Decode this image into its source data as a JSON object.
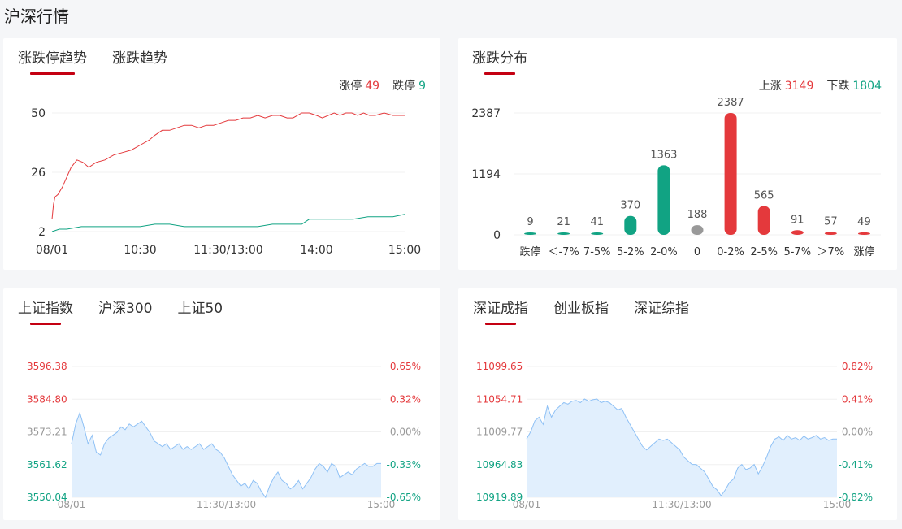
{
  "page": {
    "title": "沪深行情"
  },
  "colors": {
    "red": "#e4393c",
    "green": "#11a383",
    "gray": "#999999",
    "blue_line": "#8fc1f5",
    "blue_fill": "#e1effd",
    "accent": "#c40012"
  },
  "panel1": {
    "tabs": [
      "涨跌停趋势",
      "涨跌趋势"
    ],
    "legend": {
      "up_label": "涨停",
      "up_value": "49",
      "down_label": "跌停",
      "down_value": "9"
    }
  },
  "panel2": {
    "tabs": [
      "涨跌分布"
    ],
    "legend": {
      "up_label": "上涨",
      "up_value": "3149",
      "down_label": "下跌",
      "down_value": "1804"
    }
  },
  "panel3": {
    "tabs": [
      "上证指数",
      "沪深300",
      "上证50"
    ]
  },
  "panel4": {
    "tabs": [
      "深证成指",
      "创业板指",
      "深证综指"
    ]
  },
  "chart_data": [
    {
      "type": "line",
      "yticks": [
        "50",
        "26",
        "2"
      ],
      "ylim": [
        2,
        50
      ],
      "xticks": [
        "08/01",
        "10:30",
        "11:30/13:00",
        "14:00",
        "15:00"
      ],
      "series": [
        {
          "name": "涨停",
          "color": "#e4393c",
          "points": [
            [
              0,
              7
            ],
            [
              1,
              13
            ],
            [
              2,
              16
            ],
            [
              4,
              17
            ],
            [
              7,
              20
            ],
            [
              10,
              24
            ],
            [
              13,
              28
            ],
            [
              17,
              31
            ],
            [
              21,
              30
            ],
            [
              25,
              28
            ],
            [
              30,
              30
            ],
            [
              36,
              31
            ],
            [
              42,
              33
            ],
            [
              48,
              34
            ],
            [
              54,
              35
            ],
            [
              60,
              37
            ],
            [
              66,
              39
            ],
            [
              70,
              41
            ],
            [
              75,
              43
            ],
            [
              80,
              43
            ],
            [
              85,
              44
            ],
            [
              90,
              45
            ],
            [
              95,
              45
            ],
            [
              100,
              44
            ],
            [
              105,
              45
            ],
            [
              110,
              45
            ],
            [
              115,
              46
            ],
            [
              120,
              47
            ],
            [
              125,
              47
            ],
            [
              130,
              48
            ],
            [
              135,
              48
            ],
            [
              140,
              49
            ],
            [
              145,
              48
            ],
            [
              150,
              49
            ],
            [
              155,
              49
            ],
            [
              160,
              48
            ],
            [
              164,
              48
            ],
            [
              170,
              50
            ],
            [
              175,
              50
            ],
            [
              180,
              49
            ],
            [
              184,
              48
            ],
            [
              188,
              49
            ],
            [
              192,
              50
            ],
            [
              196,
              49
            ],
            [
              200,
              50
            ],
            [
              204,
              50
            ],
            [
              208,
              49
            ],
            [
              212,
              50
            ],
            [
              216,
              49
            ],
            [
              220,
              49
            ],
            [
              226,
              50
            ],
            [
              232,
              49
            ],
            [
              240,
              49
            ]
          ]
        },
        {
          "name": "跌停",
          "color": "#11a383",
          "points": [
            [
              0,
              2
            ],
            [
              5,
              3
            ],
            [
              10,
              3
            ],
            [
              20,
              4
            ],
            [
              30,
              4
            ],
            [
              40,
              4
            ],
            [
              50,
              4
            ],
            [
              60,
              4
            ],
            [
              70,
              5
            ],
            [
              80,
              5
            ],
            [
              90,
              4
            ],
            [
              100,
              4
            ],
            [
              110,
              4
            ],
            [
              120,
              4
            ],
            [
              130,
              4
            ],
            [
              140,
              4
            ],
            [
              150,
              5
            ],
            [
              160,
              5
            ],
            [
              170,
              5
            ],
            [
              175,
              7
            ],
            [
              185,
              7
            ],
            [
              195,
              7
            ],
            [
              205,
              7
            ],
            [
              215,
              8
            ],
            [
              225,
              8
            ],
            [
              232,
              8
            ],
            [
              240,
              9
            ]
          ]
        }
      ]
    },
    {
      "type": "bar",
      "categories": [
        "跌停",
        "＜-7%",
        "7-5%",
        "5-2%",
        "2-0%",
        "0",
        "0-2%",
        "2-5%",
        "5-7%",
        "＞7%",
        "涨停"
      ],
      "values": [
        9,
        21,
        41,
        370,
        1363,
        188,
        2387,
        565,
        91,
        57,
        49
      ],
      "colors": [
        "#11a383",
        "#11a383",
        "#11a383",
        "#11a383",
        "#11a383",
        "#999999",
        "#e4393c",
        "#e4393c",
        "#e4393c",
        "#e4393c",
        "#e4393c"
      ],
      "yticks": [
        "2387",
        "1194",
        "0"
      ],
      "ylim": [
        0,
        2387
      ]
    },
    {
      "type": "area",
      "name": "上证指数",
      "left_ticks": [
        "3596.38",
        "3584.80",
        "3573.21",
        "3561.62",
        "3550.04"
      ],
      "right_ticks": [
        "0.65%",
        "0.32%",
        "0.00%",
        "-0.33%",
        "-0.65%"
      ],
      "ylim": [
        3550.04,
        3596.38
      ],
      "xticks": [
        "08/01",
        "11:30/13:00",
        "15:00"
      ],
      "values": [
        3569,
        3576,
        3580,
        3575,
        3569,
        3572,
        3566,
        3565,
        3569,
        3571,
        3572,
        3573,
        3575,
        3574,
        3576,
        3575,
        3576,
        3577,
        3575,
        3573,
        3570,
        3569,
        3568,
        3569,
        3567,
        3568,
        3569,
        3567,
        3568,
        3567,
        3568,
        3569,
        3567,
        3568,
        3569,
        3567,
        3566,
        3564,
        3561,
        3558,
        3556,
        3554,
        3555,
        3553,
        3556,
        3555,
        3552,
        3550,
        3554,
        3557,
        3559,
        3556,
        3555,
        3553,
        3554,
        3556,
        3553,
        3555,
        3557,
        3560,
        3562,
        3561,
        3559,
        3562,
        3561,
        3557,
        3558,
        3559,
        3558,
        3560,
        3561,
        3562,
        3561,
        3561,
        3562,
        3562
      ]
    },
    {
      "type": "area",
      "name": "深证成指",
      "left_ticks": [
        "11099.65",
        "11054.71",
        "11009.77",
        "10964.83",
        "10919.89"
      ],
      "right_ticks": [
        "0.82%",
        "0.41%",
        "0.00%",
        "-0.41%",
        "-0.82%"
      ],
      "ylim": [
        10919.89,
        11099.65
      ],
      "xticks": [
        "08/01",
        "11:30/13:00",
        "15:00"
      ],
      "values": [
        11000,
        11010,
        11025,
        11030,
        11020,
        11045,
        11030,
        11040,
        11045,
        11050,
        11048,
        11052,
        11053,
        11050,
        11055,
        11052,
        11054,
        11055,
        11050,
        11052,
        11050,
        11045,
        11040,
        11042,
        11030,
        11020,
        11010,
        11000,
        10990,
        10985,
        10990,
        10995,
        11000,
        10998,
        11000,
        10995,
        10990,
        10985,
        10975,
        10970,
        10965,
        10965,
        10960,
        10955,
        10945,
        10935,
        10930,
        10922,
        10930,
        10940,
        10945,
        10960,
        10965,
        10958,
        10960,
        10965,
        10952,
        10962,
        10975,
        10990,
        11000,
        11003,
        10998,
        11005,
        11000,
        11002,
        10998,
        11004,
        11000,
        11002,
        11005,
        11000,
        11002,
        10998,
        11000,
        11000
      ]
    }
  ]
}
